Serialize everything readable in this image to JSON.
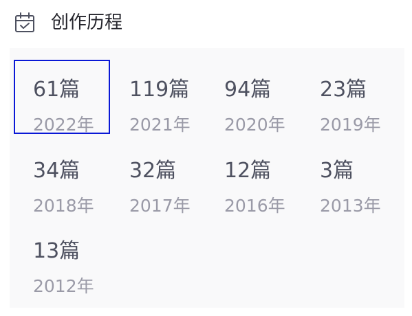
{
  "header": {
    "title": "创作历程",
    "icon": "calendar-check-icon"
  },
  "items": [
    {
      "count": "61篇",
      "year": "2022年"
    },
    {
      "count": "119篇",
      "year": "2021年"
    },
    {
      "count": "94篇",
      "year": "2020年"
    },
    {
      "count": "23篇",
      "year": "2019年"
    },
    {
      "count": "34篇",
      "year": "2018年"
    },
    {
      "count": "32篇",
      "year": "2017年"
    },
    {
      "count": "12篇",
      "year": "2016年"
    },
    {
      "count": "3篇",
      "year": "2013年"
    },
    {
      "count": "13篇",
      "year": "2012年"
    }
  ],
  "colors": {
    "selected_border": "#0a18d6",
    "count_text": "#4e5160",
    "year_text": "#9a9aa7",
    "panel_background": "#f9f9fa"
  }
}
